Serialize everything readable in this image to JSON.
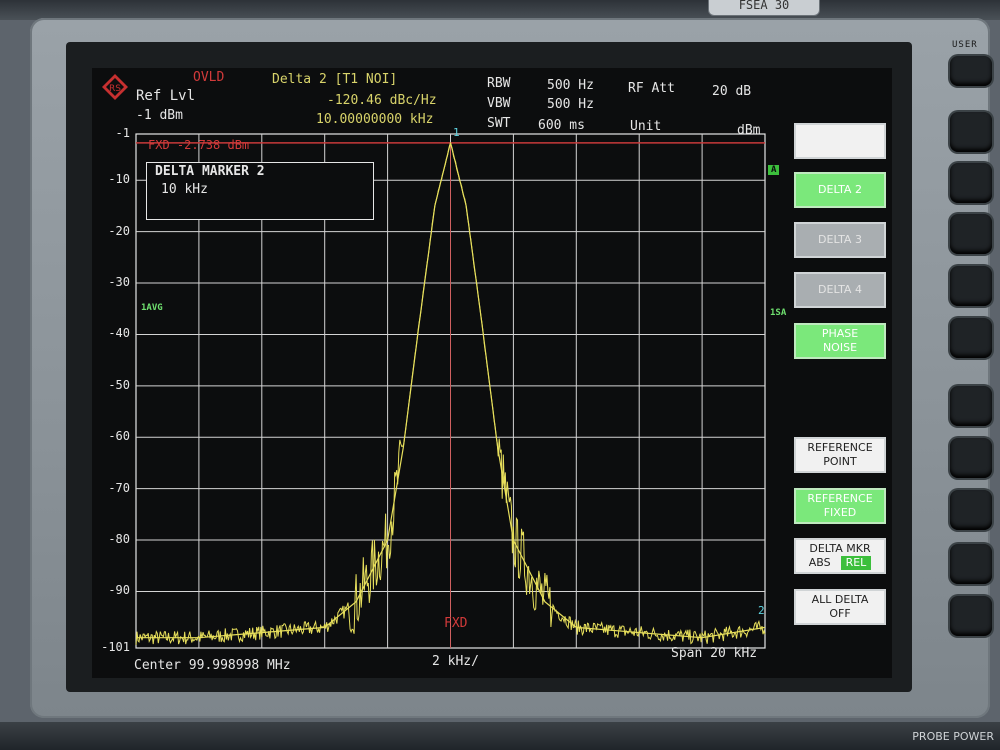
{
  "device": {
    "brand_tab": "FSEA 30",
    "user_label": "USER",
    "probe_power": "PROBE POWER"
  },
  "header": {
    "ovld": "OVLD",
    "ref_lvl_label": "Ref Lvl",
    "ref_lvl_value": "-1 dBm",
    "marker_title": "Delta 2 [T1 NOI]",
    "marker_level": "-120.46 dBc/Hz",
    "marker_freq": "10.00000000 kHz",
    "rbw_label": "RBW",
    "rbw_value": "500 Hz",
    "vbw_label": "VBW",
    "vbw_value": "500 Hz",
    "swt_label": "SWT",
    "swt_value": "600 ms",
    "rf_att_label": "RF Att",
    "rf_att_value": "20 dB",
    "unit_label": "Unit",
    "unit_value": "dBm"
  },
  "display": {
    "fxd_line": "FXD -2.738 dBm",
    "fxd_marker": "FXD",
    "delta_box_title": "DELTA MARKER 2",
    "delta_box_value": "10 kHz",
    "avg_label": "1AVG",
    "a_tag": "A",
    "sa_tag": "1SA",
    "marker1_tag": "1",
    "marker2_tag": "2",
    "center": "Center 99.998998 MHz",
    "per_div": "2 kHz/",
    "span": "Span 20 kHz",
    "y_ticks": [
      "-1",
      "-10",
      "-20",
      "-30",
      "-40",
      "-50",
      "-60",
      "-70",
      "-80",
      "-90",
      "-101"
    ]
  },
  "softkeys": [
    {
      "label": "",
      "style": "white"
    },
    {
      "label": "DELTA 2",
      "style": "green"
    },
    {
      "label": "DELTA 3",
      "style": "grey"
    },
    {
      "label": "DELTA 4",
      "style": "grey"
    },
    {
      "label": "PHASE NOISE",
      "line1": "PHASE",
      "line2": "NOISE",
      "style": "green"
    },
    {
      "label": "REFERENCE POINT",
      "line1": "REFERENCE",
      "line2": "POINT",
      "style": "white"
    },
    {
      "label": "REFERENCE FIXED",
      "line1": "REFERENCE",
      "line2": "FIXED",
      "style": "green"
    },
    {
      "label": "DELTA MKR ABS REL",
      "line1": "DELTA MKR",
      "line2a": "ABS",
      "line2b": "REL",
      "style": "white"
    },
    {
      "label": "ALL DELTA OFF",
      "line1": "ALL DELTA",
      "line2": "OFF",
      "style": "white"
    }
  ],
  "chart_data": {
    "type": "line",
    "title": "",
    "xlabel": "",
    "ylabel": "",
    "ylim": [
      -101,
      -1
    ],
    "y_ticks": [
      -1,
      -10,
      -20,
      -30,
      -40,
      -50,
      -60,
      -70,
      -80,
      -90,
      -101
    ],
    "x_center_mhz": 99.998998,
    "span_khz": 20,
    "x_div_khz": 2,
    "reference_line_dbm": -2.738,
    "grid": true,
    "series": [
      {
        "x_khz": [
          -10,
          -8,
          -6,
          -4,
          -3,
          -2,
          -1.5,
          -1,
          -0.5,
          0,
          0.5,
          1,
          1.5,
          2,
          3,
          4,
          6,
          8,
          10
        ],
        "y_db": [
          -99,
          -99,
          -98,
          -97,
          -92,
          -80,
          -62,
          -38,
          -15,
          -2.7,
          -15,
          -38,
          -62,
          -80,
          -92,
          -97,
          -98,
          -99,
          -97
        ]
      }
    ]
  }
}
